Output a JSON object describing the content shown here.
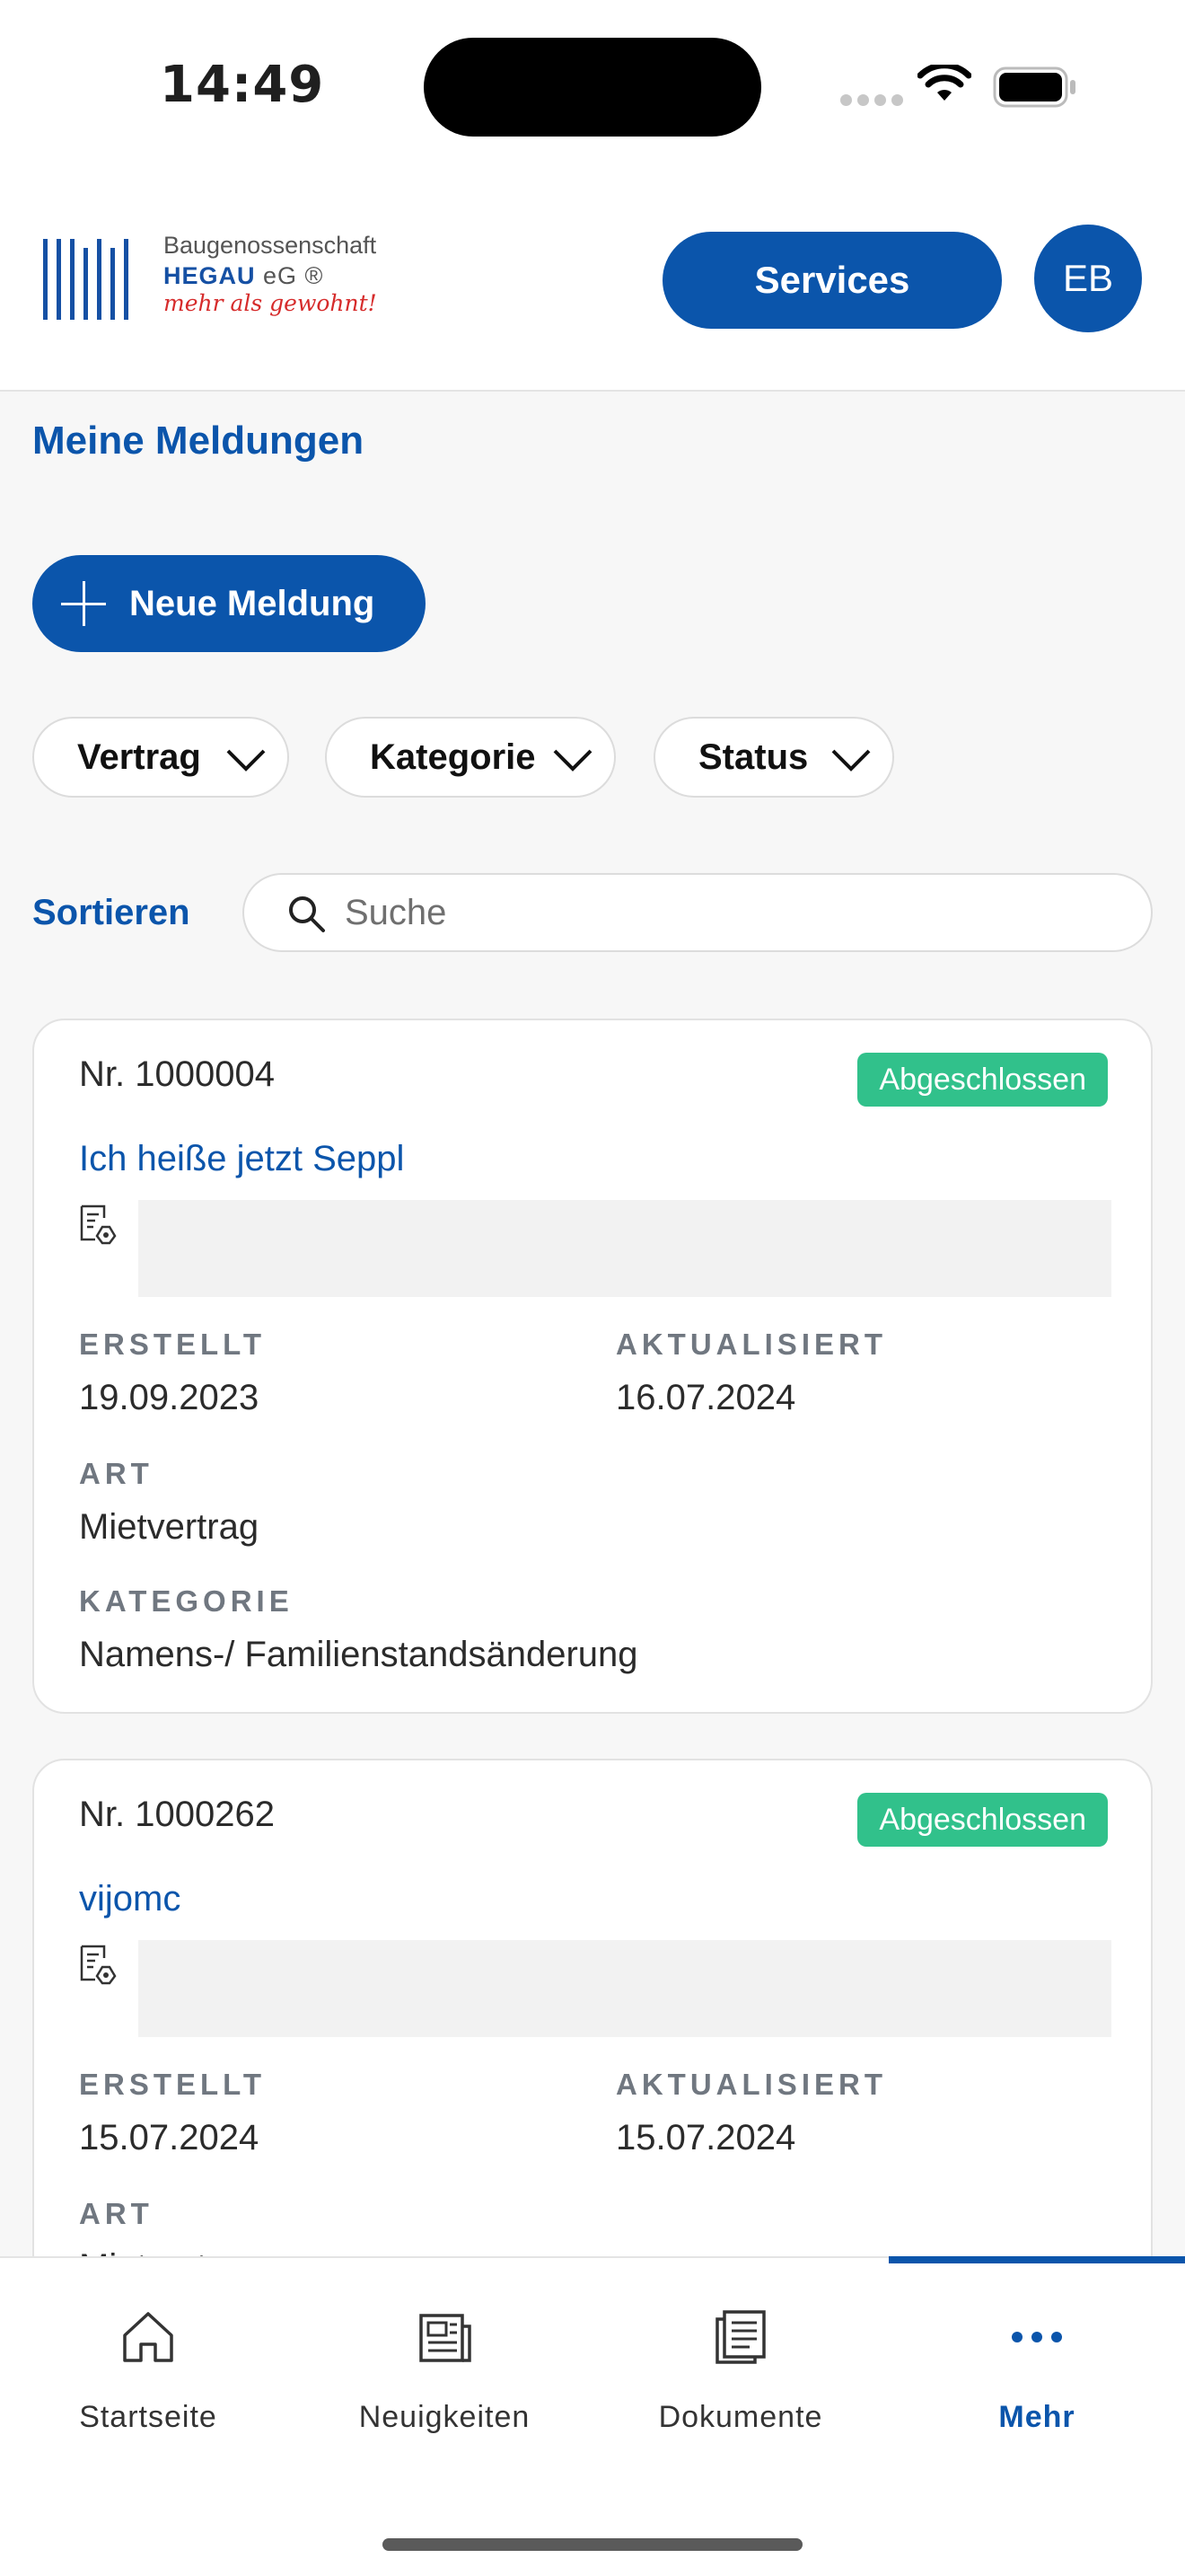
{
  "status_bar": {
    "time": "14:49"
  },
  "header": {
    "logo_line1": "Baugenossenschaft",
    "logo_line2": "HEGAU",
    "logo_line2_suffix": "eG ®",
    "logo_line3": "mehr als gewohnt!",
    "services_label": "Services",
    "avatar_initials": "EB"
  },
  "page": {
    "title": "Meine Meldungen",
    "new_button_label": "Neue Meldung",
    "filters": [
      "Vertrag",
      "Kategorie",
      "Status"
    ],
    "sort_label": "Sortieren",
    "search_placeholder": "Suche"
  },
  "labels": {
    "created": "ERSTELLT",
    "updated": "AKTUALISIERT",
    "type": "ART",
    "category": "KATEGORIE"
  },
  "cards": [
    {
      "number": "Nr. 1000004",
      "status": "Abgeschlossen",
      "title": "Ich heiße jetzt Seppl",
      "created": "19.09.2023",
      "updated": "16.07.2024",
      "type": "Mietvertrag",
      "category": "Namens-/ Familienstandsänderung"
    },
    {
      "number": "Nr. 1000262",
      "status": "Abgeschlossen",
      "title": "vijomc",
      "created": "15.07.2024",
      "updated": "15.07.2024",
      "type": "Mietvertrag"
    }
  ],
  "bottom_nav": [
    {
      "label": "Startseite",
      "icon": "home-icon"
    },
    {
      "label": "Neuigkeiten",
      "icon": "news-icon"
    },
    {
      "label": "Dokumente",
      "icon": "document-icon"
    },
    {
      "label": "Mehr",
      "icon": "more-icon",
      "active": true
    }
  ],
  "colors": {
    "primary": "#0b55ab",
    "status_done": "#31c18b",
    "logo_accent": "#d62b2b"
  }
}
